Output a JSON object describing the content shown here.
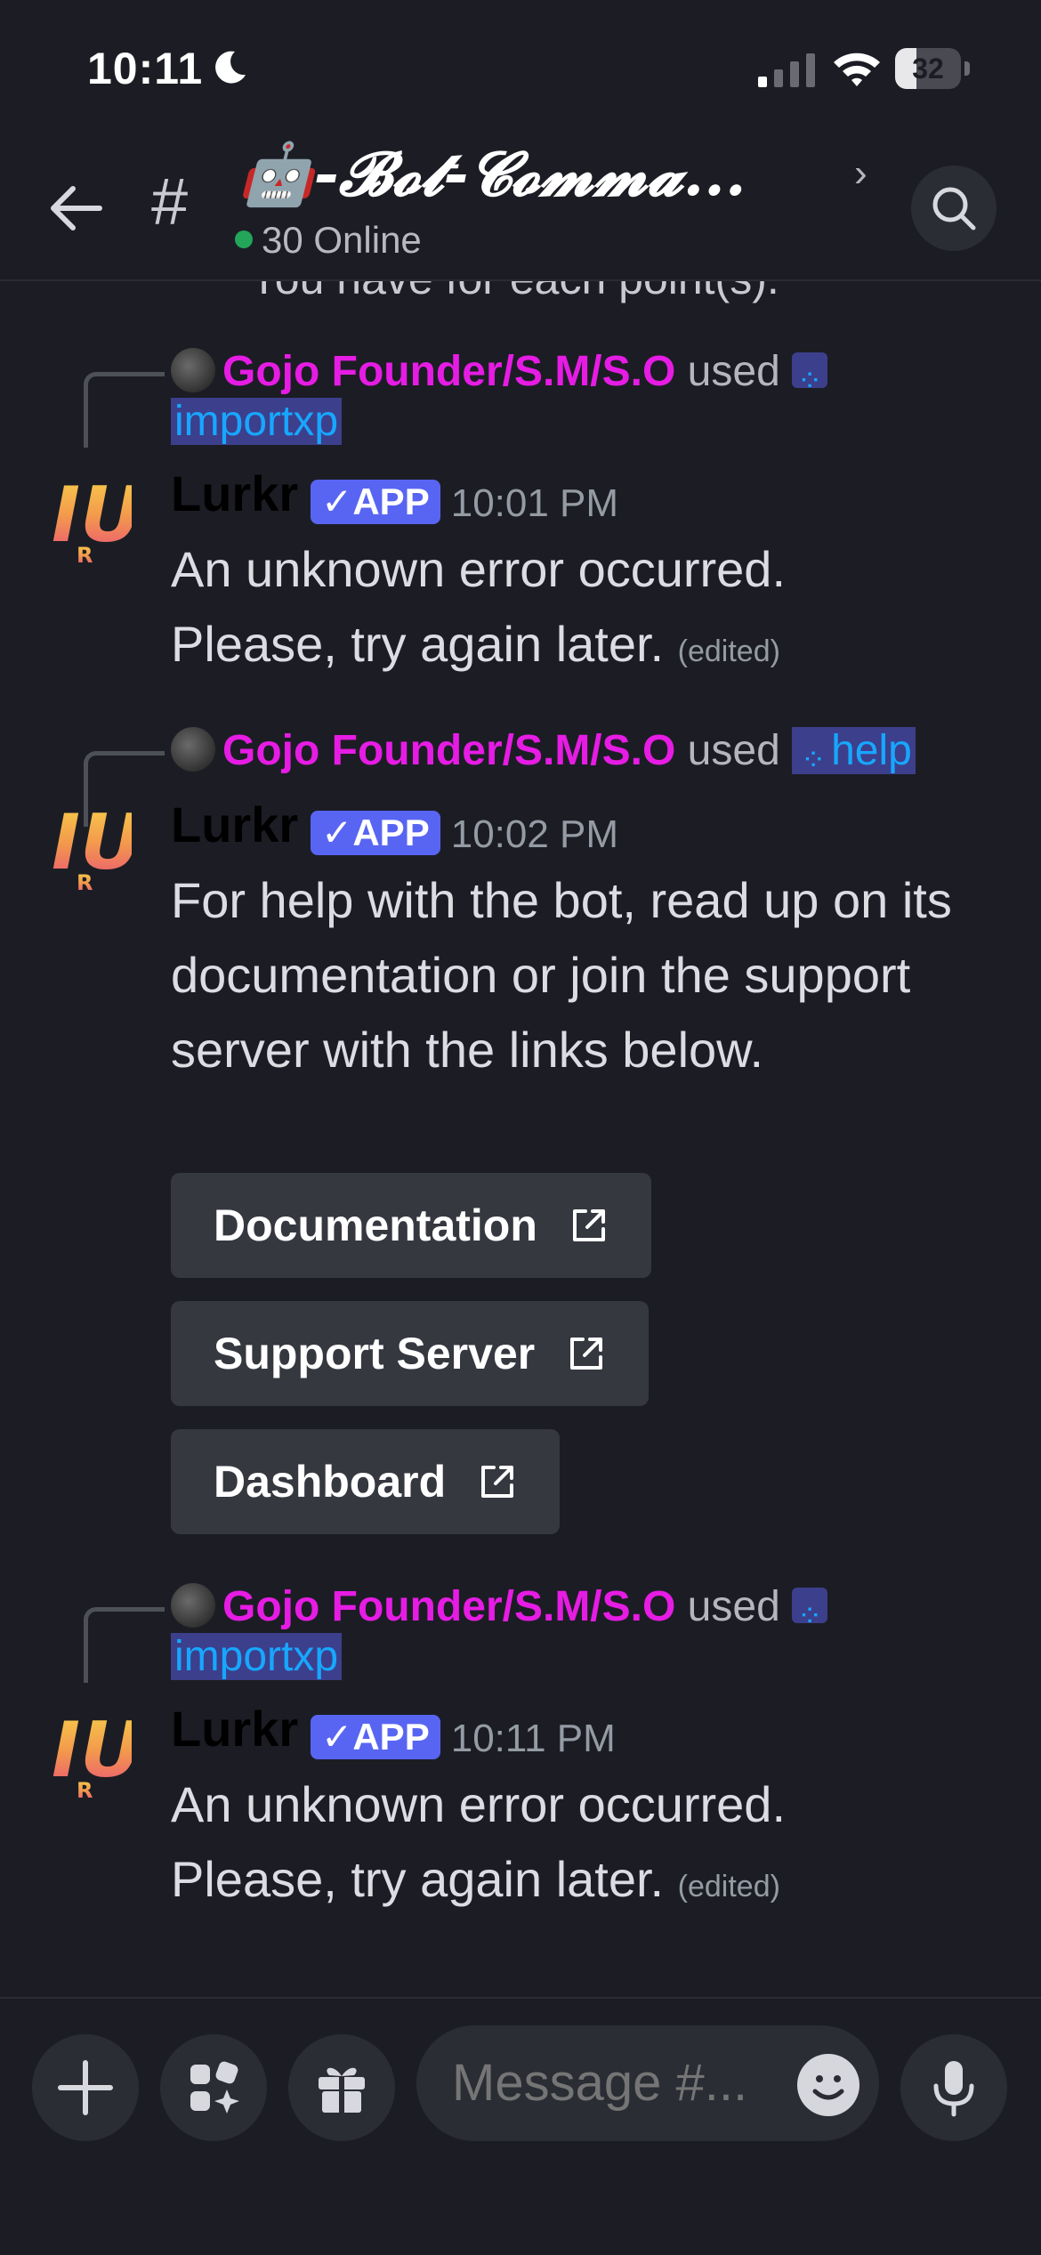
{
  "status_bar": {
    "time": "10:11",
    "battery": "32",
    "battery_level": 0.32
  },
  "header": {
    "channel_emoji": "🤖",
    "channel_name": "-𝓑𝓸𝓽-𝓒𝓸𝓶𝓶𝓪...",
    "online": "30 Online"
  },
  "partial_text": "You have for each point(s).",
  "messages": [
    {
      "reply": {
        "user": "Gojo Founder/S.M/S.O",
        "used": "used",
        "command": "importxp"
      },
      "author": "Lurkr",
      "badge": "✓APP",
      "time": "10:01 PM",
      "lines": [
        "An unknown error occurred.",
        "Please, try again later."
      ],
      "edited": "(edited)"
    },
    {
      "reply": {
        "user": "Gojo Founder/S.M/S.O",
        "used": "used",
        "command": "help"
      },
      "author": "Lurkr",
      "badge": "✓APP",
      "time": "10:02 PM",
      "text": "For help with the bot, read up on its documentation or join the support server with the links below.",
      "buttons": [
        "Documentation",
        "Support Server",
        "Dashboard"
      ]
    },
    {
      "reply": {
        "user": "Gojo Founder/S.M/S.O",
        "used": "used",
        "command": "importxp"
      },
      "author": "Lurkr",
      "badge": "✓APP",
      "time": "10:11 PM",
      "lines": [
        "An unknown error occurred.",
        "Please, try again later."
      ],
      "edited": "(edited)"
    }
  ],
  "composer": {
    "placeholder": "Message #..."
  },
  "colors": {
    "background": "#1c1d24",
    "reply_user": "#e61ce4",
    "app_badge": "#5865f2",
    "command": "#17a7ff",
    "online": "#23a55a"
  }
}
